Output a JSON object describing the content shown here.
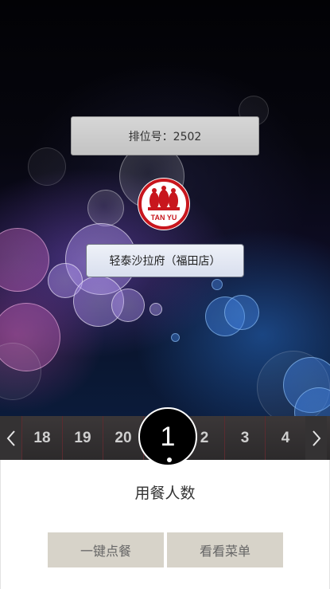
{
  "queue": {
    "label": "排位号：2502"
  },
  "logo": {
    "text": "TAN YU",
    "color": "#c8161d"
  },
  "store": {
    "name": "轻泰沙拉府（福田店）"
  },
  "guest_picker": {
    "numbers": [
      "18",
      "19",
      "20",
      "1",
      "2",
      "3",
      "4"
    ],
    "selected": "1"
  },
  "diners": {
    "label": "用餐人数"
  },
  "actions": {
    "order_label": "一键点餐",
    "menu_label": "看看菜单"
  },
  "colors": {
    "button_bg": "#d7d3c9",
    "bar_bg": "#2f2c2d",
    "selected_bg": "#000000"
  }
}
